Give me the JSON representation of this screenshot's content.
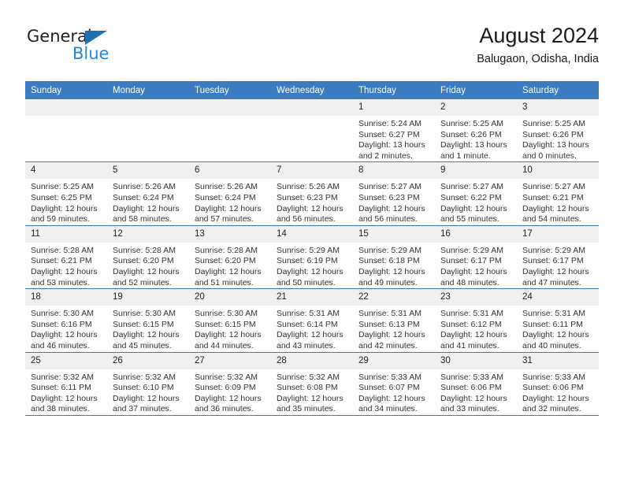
{
  "logo": {
    "primary_text": "General",
    "secondary_text": "Blue",
    "primary_color": "#231f20",
    "secondary_color": "#2787d4",
    "triangle_color": "#1f6fb5",
    "triangle_icon": "triangle-icon"
  },
  "header": {
    "title": "August 2024",
    "subtitle": "Balugaon, Odisha, India"
  },
  "theme": {
    "header_bg": "#3b7cc0",
    "header_text": "#ffffff",
    "daynum_bg": "#f0f0f0",
    "row_border": "#3b7cc0",
    "body_text": "#333333"
  },
  "columns": [
    "Sunday",
    "Monday",
    "Tuesday",
    "Wednesday",
    "Thursday",
    "Friday",
    "Saturday"
  ],
  "weeks": [
    [
      {
        "day": "",
        "empty": true
      },
      {
        "day": "",
        "empty": true
      },
      {
        "day": "",
        "empty": true
      },
      {
        "day": "",
        "empty": true
      },
      {
        "day": "1",
        "sunrise": "Sunrise: 5:24 AM",
        "sunset": "Sunset: 6:27 PM",
        "daylight": "Daylight: 13 hours and 2 minutes."
      },
      {
        "day": "2",
        "sunrise": "Sunrise: 5:25 AM",
        "sunset": "Sunset: 6:26 PM",
        "daylight": "Daylight: 13 hours and 1 minute."
      },
      {
        "day": "3",
        "sunrise": "Sunrise: 5:25 AM",
        "sunset": "Sunset: 6:26 PM",
        "daylight": "Daylight: 13 hours and 0 minutes."
      }
    ],
    [
      {
        "day": "4",
        "sunrise": "Sunrise: 5:25 AM",
        "sunset": "Sunset: 6:25 PM",
        "daylight": "Daylight: 12 hours and 59 minutes."
      },
      {
        "day": "5",
        "sunrise": "Sunrise: 5:26 AM",
        "sunset": "Sunset: 6:24 PM",
        "daylight": "Daylight: 12 hours and 58 minutes."
      },
      {
        "day": "6",
        "sunrise": "Sunrise: 5:26 AM",
        "sunset": "Sunset: 6:24 PM",
        "daylight": "Daylight: 12 hours and 57 minutes."
      },
      {
        "day": "7",
        "sunrise": "Sunrise: 5:26 AM",
        "sunset": "Sunset: 6:23 PM",
        "daylight": "Daylight: 12 hours and 56 minutes."
      },
      {
        "day": "8",
        "sunrise": "Sunrise: 5:27 AM",
        "sunset": "Sunset: 6:23 PM",
        "daylight": "Daylight: 12 hours and 56 minutes."
      },
      {
        "day": "9",
        "sunrise": "Sunrise: 5:27 AM",
        "sunset": "Sunset: 6:22 PM",
        "daylight": "Daylight: 12 hours and 55 minutes."
      },
      {
        "day": "10",
        "sunrise": "Sunrise: 5:27 AM",
        "sunset": "Sunset: 6:21 PM",
        "daylight": "Daylight: 12 hours and 54 minutes."
      }
    ],
    [
      {
        "day": "11",
        "sunrise": "Sunrise: 5:28 AM",
        "sunset": "Sunset: 6:21 PM",
        "daylight": "Daylight: 12 hours and 53 minutes."
      },
      {
        "day": "12",
        "sunrise": "Sunrise: 5:28 AM",
        "sunset": "Sunset: 6:20 PM",
        "daylight": "Daylight: 12 hours and 52 minutes."
      },
      {
        "day": "13",
        "sunrise": "Sunrise: 5:28 AM",
        "sunset": "Sunset: 6:20 PM",
        "daylight": "Daylight: 12 hours and 51 minutes."
      },
      {
        "day": "14",
        "sunrise": "Sunrise: 5:29 AM",
        "sunset": "Sunset: 6:19 PM",
        "daylight": "Daylight: 12 hours and 50 minutes."
      },
      {
        "day": "15",
        "sunrise": "Sunrise: 5:29 AM",
        "sunset": "Sunset: 6:18 PM",
        "daylight": "Daylight: 12 hours and 49 minutes."
      },
      {
        "day": "16",
        "sunrise": "Sunrise: 5:29 AM",
        "sunset": "Sunset: 6:17 PM",
        "daylight": "Daylight: 12 hours and 48 minutes."
      },
      {
        "day": "17",
        "sunrise": "Sunrise: 5:29 AM",
        "sunset": "Sunset: 6:17 PM",
        "daylight": "Daylight: 12 hours and 47 minutes."
      }
    ],
    [
      {
        "day": "18",
        "sunrise": "Sunrise: 5:30 AM",
        "sunset": "Sunset: 6:16 PM",
        "daylight": "Daylight: 12 hours and 46 minutes."
      },
      {
        "day": "19",
        "sunrise": "Sunrise: 5:30 AM",
        "sunset": "Sunset: 6:15 PM",
        "daylight": "Daylight: 12 hours and 45 minutes."
      },
      {
        "day": "20",
        "sunrise": "Sunrise: 5:30 AM",
        "sunset": "Sunset: 6:15 PM",
        "daylight": "Daylight: 12 hours and 44 minutes."
      },
      {
        "day": "21",
        "sunrise": "Sunrise: 5:31 AM",
        "sunset": "Sunset: 6:14 PM",
        "daylight": "Daylight: 12 hours and 43 minutes."
      },
      {
        "day": "22",
        "sunrise": "Sunrise: 5:31 AM",
        "sunset": "Sunset: 6:13 PM",
        "daylight": "Daylight: 12 hours and 42 minutes."
      },
      {
        "day": "23",
        "sunrise": "Sunrise: 5:31 AM",
        "sunset": "Sunset: 6:12 PM",
        "daylight": "Daylight: 12 hours and 41 minutes."
      },
      {
        "day": "24",
        "sunrise": "Sunrise: 5:31 AM",
        "sunset": "Sunset: 6:11 PM",
        "daylight": "Daylight: 12 hours and 40 minutes."
      }
    ],
    [
      {
        "day": "25",
        "sunrise": "Sunrise: 5:32 AM",
        "sunset": "Sunset: 6:11 PM",
        "daylight": "Daylight: 12 hours and 38 minutes."
      },
      {
        "day": "26",
        "sunrise": "Sunrise: 5:32 AM",
        "sunset": "Sunset: 6:10 PM",
        "daylight": "Daylight: 12 hours and 37 minutes."
      },
      {
        "day": "27",
        "sunrise": "Sunrise: 5:32 AM",
        "sunset": "Sunset: 6:09 PM",
        "daylight": "Daylight: 12 hours and 36 minutes."
      },
      {
        "day": "28",
        "sunrise": "Sunrise: 5:32 AM",
        "sunset": "Sunset: 6:08 PM",
        "daylight": "Daylight: 12 hours and 35 minutes."
      },
      {
        "day": "29",
        "sunrise": "Sunrise: 5:33 AM",
        "sunset": "Sunset: 6:07 PM",
        "daylight": "Daylight: 12 hours and 34 minutes."
      },
      {
        "day": "30",
        "sunrise": "Sunrise: 5:33 AM",
        "sunset": "Sunset: 6:06 PM",
        "daylight": "Daylight: 12 hours and 33 minutes."
      },
      {
        "day": "31",
        "sunrise": "Sunrise: 5:33 AM",
        "sunset": "Sunset: 6:06 PM",
        "daylight": "Daylight: 12 hours and 32 minutes."
      }
    ]
  ]
}
